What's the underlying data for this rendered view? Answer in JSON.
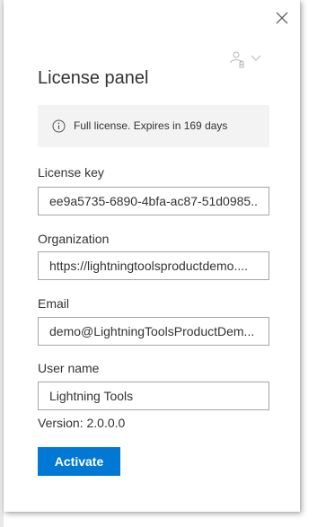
{
  "panel": {
    "title": "License panel"
  },
  "info": {
    "icon": "info-icon",
    "message": "Full license. Expires in 169 days"
  },
  "fields": {
    "license_key": {
      "label": "License key",
      "value": "ee9a5735-6890-4bfa-ac87-51d0985..."
    },
    "organization": {
      "label": "Organization",
      "value": "https://lightningtoolsproductdemo...."
    },
    "email": {
      "label": "Email",
      "value": "demo@LightningToolsProductDem..."
    },
    "user_name": {
      "label": "User name",
      "value": "Lightning Tools"
    }
  },
  "version_text": "Version: 2.0.0.0",
  "activate_label": "Activate",
  "icons": {
    "close": "close-icon",
    "account": "account-switch-icon",
    "chevron": "chevron-down-icon"
  },
  "colors": {
    "primary": "#0078d4",
    "info_bg": "#f3f3f3",
    "text": "#333333",
    "border": "#a6a6a6"
  }
}
